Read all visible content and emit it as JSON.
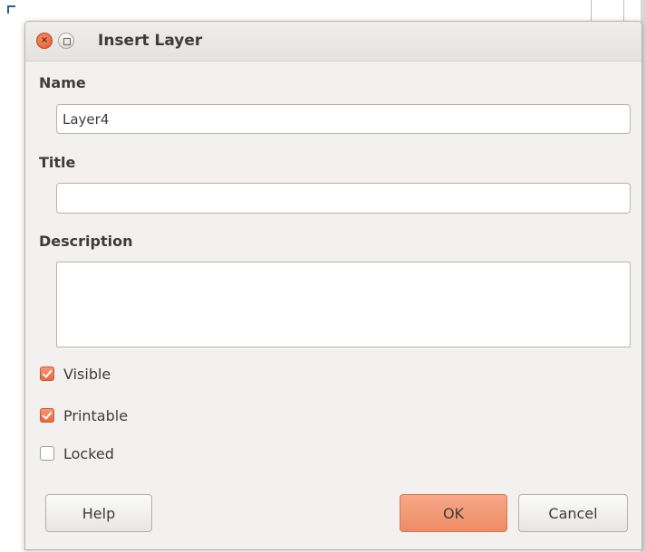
{
  "dialog": {
    "title": "Insert Layer"
  },
  "form": {
    "name_label": "Name",
    "name_value": "Layer4",
    "title_label": "Title",
    "title_value": "",
    "description_label": "Description",
    "description_value": ""
  },
  "options": [
    {
      "label": "Visible",
      "checked": true
    },
    {
      "label": "Printable",
      "checked": true
    },
    {
      "label": "Locked",
      "checked": false
    }
  ],
  "buttons": {
    "help": "Help",
    "ok": "OK",
    "cancel": "Cancel"
  },
  "colors": {
    "accent": "#ee8c66",
    "checkbox_checked": "#e9683d",
    "close_button": "#e2572d"
  }
}
